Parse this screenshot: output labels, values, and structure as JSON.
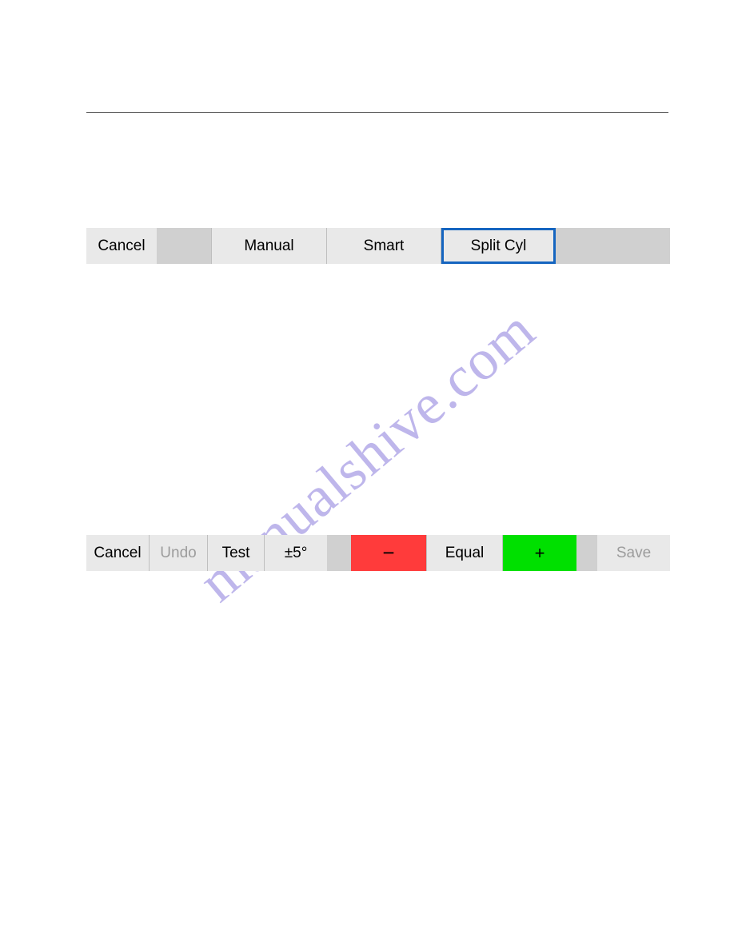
{
  "watermark": "manualshive.com",
  "top_toolbar": {
    "cancel": "Cancel",
    "manual": "Manual",
    "smart": "Smart",
    "split_cyl": "Split Cyl"
  },
  "bottom_toolbar": {
    "cancel": "Cancel",
    "undo": "Undo",
    "test": "Test",
    "plus_minus_5": "±5°",
    "minus": "−",
    "equal": "Equal",
    "plus": "+",
    "save": "Save"
  }
}
